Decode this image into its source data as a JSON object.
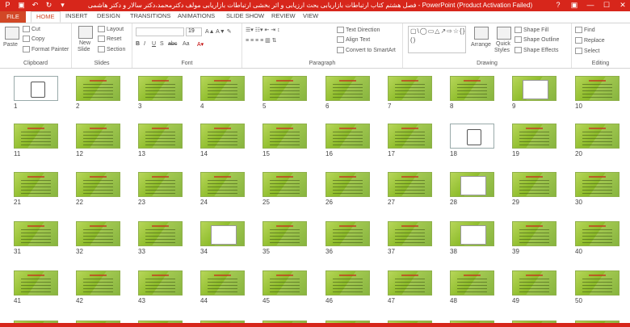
{
  "window": {
    "title": "فصل هشتم کتاب ارتباطات بازاریابی بحث ارزیابی و اثر بخشی ارتباطات بازاریابی مولف دکترمحمد،دکتر سالار و دکتر هاشمی - PowerPoint (Product Activation Failed)",
    "controls": [
      "?",
      "▣",
      "—",
      "☐",
      "✕"
    ]
  },
  "tabs": [
    "FILE",
    "HOME",
    "INSERT",
    "DESIGN",
    "TRANSITIONS",
    "ANIMATIONS",
    "SLIDE SHOW",
    "REVIEW",
    "VIEW"
  ],
  "ribbon": {
    "clipboard": {
      "paste": "Paste",
      "cut": "Cut",
      "copy": "Copy",
      "format_painter": "Format Painter",
      "label": "Clipboard"
    },
    "slides": {
      "new_slide": "New",
      "new_slide2": "Slide",
      "layout": "Layout",
      "reset": "Reset",
      "section": "Section",
      "label": "Slides"
    },
    "font": {
      "size": "19",
      "label": "Font",
      "bold": "B",
      "italic": "I",
      "underline": "U",
      "shadow": "S",
      "strike": "abc",
      "aa": "Aa"
    },
    "paragraph": {
      "text_direction": "Text Direction",
      "align_text": "Align Text",
      "convert": "Convert to SmartArt",
      "label": "Paragraph"
    },
    "drawing": {
      "shapes": "▢\\◯▭△↗⇨☆{}()",
      "arrange": "Arrange",
      "quick1": "Quick",
      "quick2": "Styles",
      "fill": "Shape Fill",
      "outline": "Shape Outline",
      "effects": "Shape Effects",
      "label": "Drawing"
    },
    "editing": {
      "find": "Find",
      "replace": "Replace",
      "select": "Select",
      "label": "Editing"
    }
  },
  "slides": {
    "count_visible": 50,
    "numbers": [
      "1",
      "2",
      "3",
      "4",
      "5",
      "6",
      "7",
      "8",
      "9",
      "10",
      "11",
      "12",
      "13",
      "14",
      "15",
      "16",
      "17",
      "18",
      "19",
      "20",
      "21",
      "22",
      "23",
      "24",
      "25",
      "26",
      "27",
      "28",
      "29",
      "30",
      "31",
      "32",
      "33",
      "34",
      "35",
      "36",
      "37",
      "38",
      "39",
      "40",
      "41",
      "42",
      "43",
      "44",
      "45",
      "46",
      "47",
      "48",
      "49",
      "50"
    ],
    "selected": "1"
  },
  "colors": {
    "titlebar": "#d7261b",
    "file_tab": "#d24726",
    "slide_green": "#8fbd2c"
  }
}
